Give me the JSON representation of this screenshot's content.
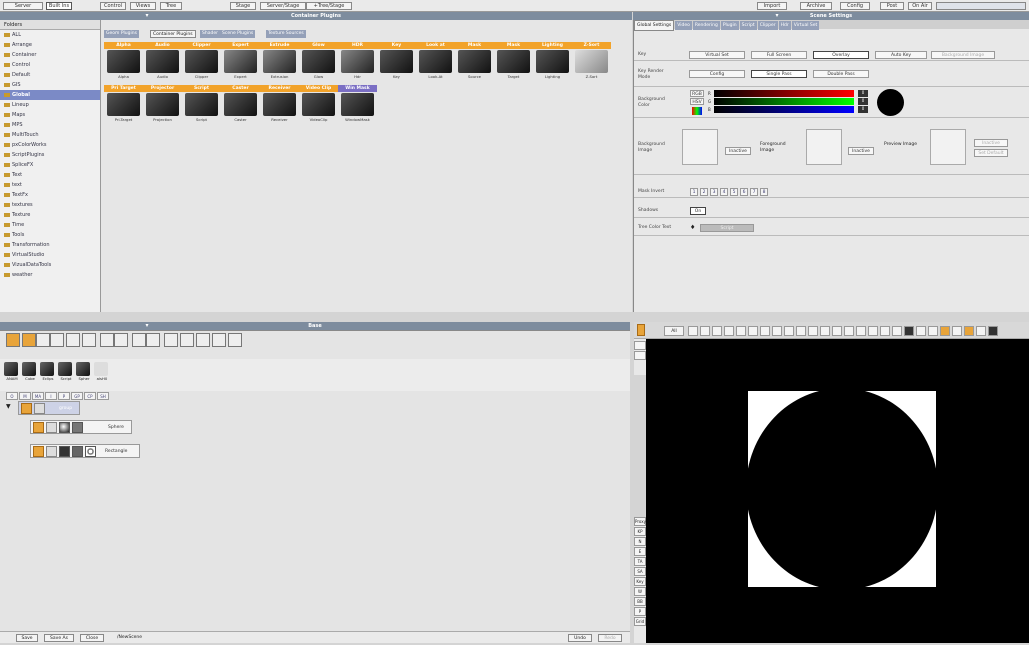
{
  "topbar": {
    "left": [
      "Server",
      "Built Ins",
      "Control",
      "Views",
      "Tree",
      "Stage",
      "Server/Stage",
      "+Tree/Stage"
    ],
    "right": [
      "Import",
      "Archive",
      "Config",
      "Post",
      "On Air"
    ]
  },
  "panels": {
    "container_plugins": "Container Plugins",
    "scene_settings": "Scene Settings",
    "base": "Base"
  },
  "folders": {
    "title": "Folders",
    "items": [
      "ALL",
      "Arrange",
      "Container",
      "Control",
      "Default",
      "GIS",
      "Global",
      "Lineup",
      "Maps",
      "MPS",
      "MultiTouch",
      "pxColorWorks",
      "ScriptPlugins",
      "SpliceFX",
      "Text",
      "text",
      "TextFx",
      "textures",
      "Texture",
      "Time",
      "Tools",
      "Transformation",
      "VirtualStudio",
      "VizualDataTools",
      "weather"
    ],
    "selected": "Global"
  },
  "plugin_tabs": [
    "Geom Plugins",
    "Container Plugins",
    "Shader",
    "Scene Plugins",
    "Texture Sources"
  ],
  "plugins": [
    {
      "label": "Alpha",
      "caption": "Alpha"
    },
    {
      "label": "Audio",
      "caption": "Audio"
    },
    {
      "label": "Clipper",
      "caption": "Clipper"
    },
    {
      "label": "Expert",
      "caption": "Expert"
    },
    {
      "label": "Extrude",
      "caption": "Extrusion"
    },
    {
      "label": "Glow",
      "caption": "Glow"
    },
    {
      "label": "HDR",
      "caption": "Hdr"
    },
    {
      "label": "Key",
      "caption": "Key"
    },
    {
      "label": "Look at",
      "caption": "Look-At"
    },
    {
      "label": "Mask",
      "caption": "Source"
    },
    {
      "label": "Mask",
      "caption": "Target"
    },
    {
      "label": "Lighting",
      "caption": "Lighting"
    },
    {
      "label": "Z-Sort",
      "caption": "Z-Sort"
    },
    {
      "label": "Pri Target",
      "caption": "Pri-Target"
    },
    {
      "label": "Projector",
      "caption": "Projection"
    },
    {
      "label": "Script",
      "caption": "Script"
    },
    {
      "label": "Caster",
      "caption": "Caster"
    },
    {
      "label": "Receiver",
      "caption": "Receiver"
    },
    {
      "label": "Video Clip",
      "caption": "VideoClip"
    },
    {
      "label": "Win Mask",
      "caption": "WindowMask"
    }
  ],
  "scene": {
    "tabs": [
      "Global Settings",
      "Video",
      "Rendering",
      "Plugin",
      "Script",
      "Clipper",
      "Hdr",
      "Virtual Set"
    ],
    "key": {
      "label": "Key",
      "options": [
        "Virtual Set",
        "Full Screen",
        "Overlay",
        "Auto Key",
        "Background Image"
      ],
      "selected": "Overlay"
    },
    "key_render": {
      "label": "Key Render Mode",
      "options": [
        "Config",
        "Single Pass",
        "Double Pass"
      ],
      "selected": "Single Pass"
    },
    "bg_color": {
      "label": "Background Color",
      "modes": [
        "RGB",
        "HSV"
      ],
      "channels": [
        "R",
        "G",
        "B"
      ],
      "values": [
        "0",
        "0",
        "0"
      ]
    },
    "images": {
      "bg_label": "Background Image",
      "fg_label": "Foreground Image",
      "preview_label": "Preview Image",
      "inactive": "Inactive",
      "set_default": "Set Default"
    },
    "mask_invert": {
      "label": "Mask Invert",
      "values": [
        "1",
        "2",
        "3",
        "4",
        "5",
        "6",
        "7",
        "8"
      ]
    },
    "shadows": {
      "label": "Shadows",
      "value": "On"
    },
    "tree_color": {
      "label": "Tree Color Text",
      "value": "Script"
    }
  },
  "base": {
    "col_tabs": [
      "O",
      "M",
      "MA",
      "I",
      "P",
      "GP",
      "CP",
      "SH"
    ],
    "toolbar_labels": [
      "ANAM",
      "Cube",
      "Eclips",
      "Script",
      "Spher",
      "alsH0"
    ],
    "tree": [
      "group",
      "Sphere",
      "Rectangle"
    ]
  },
  "bottom": {
    "buttons": [
      "Save",
      "Save As",
      "Close"
    ],
    "path": "/NewScene",
    "undo": "Undo",
    "redo": "Redo"
  },
  "viewport": {
    "label": "All",
    "side": [
      "Proxy",
      "KP",
      "N",
      "E",
      "TA",
      "SA",
      "Key",
      "W",
      "BB",
      "P",
      "Grid"
    ]
  }
}
